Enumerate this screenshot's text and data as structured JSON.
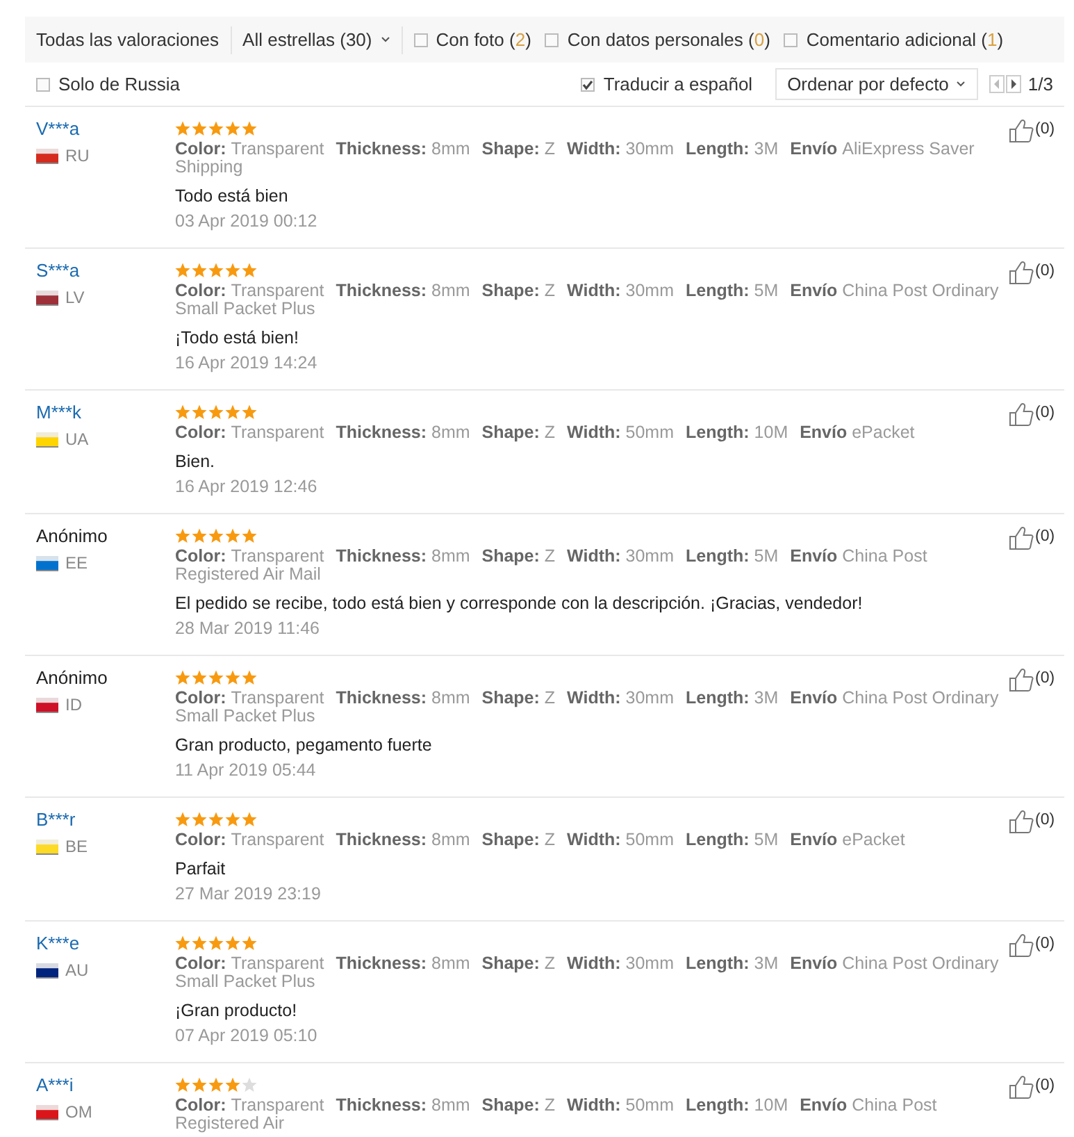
{
  "filters": {
    "all_label": "Todas las valoraciones",
    "stars_dropdown": "All estrellas (30)",
    "checks": [
      {
        "label": "Con foto",
        "count": "(2)",
        "checked": false
      },
      {
        "label": "Con datos personales",
        "count": "(0)",
        "checked": false
      },
      {
        "label": "Comentario adicional",
        "count": "(1)",
        "checked": false
      }
    ]
  },
  "options": {
    "country_filter": {
      "label": "Solo de Russia",
      "checked": false
    },
    "translate": {
      "label": "Traducir a español",
      "checked": true
    },
    "sort": "Ordenar por defecto",
    "page": "1/3"
  },
  "reviews": [
    {
      "kind": "user",
      "name": "V***a",
      "country": "RU",
      "color": "#d52b1e",
      "stars": 5,
      "attrs": [
        {
          "label": "Color:",
          "value": "Transparent"
        },
        {
          "label": "Thickness:",
          "value": "8mm"
        },
        {
          "label": "Shape:",
          "value": "Z"
        },
        {
          "label": "Width:",
          "value": "30mm"
        },
        {
          "label": "Length:",
          "value": "3M"
        },
        {
          "label": "Envío",
          "value": "AliExpress Saver Shipping"
        }
      ],
      "comment": "Todo está bien",
      "date": "03 Apr 2019 00:12",
      "likes": "(0)"
    },
    {
      "kind": "user",
      "name": "S***a",
      "country": "LV",
      "color": "#9e3039",
      "stars": 5,
      "attrs": [
        {
          "label": "Color:",
          "value": "Transparent"
        },
        {
          "label": "Thickness:",
          "value": "8mm"
        },
        {
          "label": "Shape:",
          "value": "Z"
        },
        {
          "label": "Width:",
          "value": "30mm"
        },
        {
          "label": "Length:",
          "value": "5M"
        },
        {
          "label": "Envío",
          "value": "China Post Ordinary Small Packet Plus"
        }
      ],
      "comment": "¡Todo está bien!",
      "date": "16 Apr 2019 14:24",
      "likes": "(0)"
    },
    {
      "kind": "user",
      "name": "M***k",
      "country": "UA",
      "color": "#ffd500",
      "stars": 5,
      "attrs": [
        {
          "label": "Color:",
          "value": "Transparent"
        },
        {
          "label": "Thickness:",
          "value": "8mm"
        },
        {
          "label": "Shape:",
          "value": "Z"
        },
        {
          "label": "Width:",
          "value": "50mm"
        },
        {
          "label": "Length:",
          "value": "10M"
        },
        {
          "label": "Envío",
          "value": "ePacket"
        }
      ],
      "comment": "Bien.",
      "date": "16 Apr 2019 12:46",
      "likes": "(0)"
    },
    {
      "kind": "anonymous",
      "name": "Anónimo",
      "country": "EE",
      "color": "#0072ce",
      "stars": 5,
      "attrs": [
        {
          "label": "Color:",
          "value": "Transparent"
        },
        {
          "label": "Thickness:",
          "value": "8mm"
        },
        {
          "label": "Shape:",
          "value": "Z"
        },
        {
          "label": "Width:",
          "value": "30mm"
        },
        {
          "label": "Length:",
          "value": "5M"
        },
        {
          "label": "Envío",
          "value": "China Post Registered Air Mail"
        }
      ],
      "comment": "El pedido se recibe, todo está bien y corresponde con la descripción. ¡Gracias, vendedor!",
      "date": "28 Mar 2019 11:46",
      "likes": "(0)"
    },
    {
      "kind": "anonymous",
      "name": "Anónimo",
      "country": "ID",
      "color": "#ce1126",
      "stars": 5,
      "attrs": [
        {
          "label": "Color:",
          "value": "Transparent"
        },
        {
          "label": "Thickness:",
          "value": "8mm"
        },
        {
          "label": "Shape:",
          "value": "Z"
        },
        {
          "label": "Width:",
          "value": "30mm"
        },
        {
          "label": "Length:",
          "value": "3M"
        },
        {
          "label": "Envío",
          "value": "China Post Ordinary Small Packet Plus"
        }
      ],
      "comment": "Gran producto, pegamento fuerte",
      "date": "11 Apr 2019 05:44",
      "likes": "(0)"
    },
    {
      "kind": "user",
      "name": "B***r",
      "country": "BE",
      "color": "#fdda24",
      "stars": 5,
      "attrs": [
        {
          "label": "Color:",
          "value": "Transparent"
        },
        {
          "label": "Thickness:",
          "value": "8mm"
        },
        {
          "label": "Shape:",
          "value": "Z"
        },
        {
          "label": "Width:",
          "value": "50mm"
        },
        {
          "label": "Length:",
          "value": "5M"
        },
        {
          "label": "Envío",
          "value": "ePacket"
        }
      ],
      "comment": "Parfait",
      "date": "27 Mar 2019 23:19",
      "likes": "(0)"
    },
    {
      "kind": "user",
      "name": "K***e",
      "country": "AU",
      "color": "#00247d",
      "stars": 5,
      "attrs": [
        {
          "label": "Color:",
          "value": "Transparent"
        },
        {
          "label": "Thickness:",
          "value": "8mm"
        },
        {
          "label": "Shape:",
          "value": "Z"
        },
        {
          "label": "Width:",
          "value": "30mm"
        },
        {
          "label": "Length:",
          "value": "3M"
        },
        {
          "label": "Envío",
          "value": "China Post Ordinary Small Packet Plus"
        }
      ],
      "comment": "¡Gran producto!",
      "date": "07 Apr 2019 05:10",
      "likes": "(0)"
    },
    {
      "kind": "user",
      "name": "A***i",
      "country": "OM",
      "color": "#db161b",
      "stars": 4,
      "attrs": [
        {
          "label": "Color:",
          "value": "Transparent"
        },
        {
          "label": "Thickness:",
          "value": "8mm"
        },
        {
          "label": "Shape:",
          "value": "Z"
        },
        {
          "label": "Width:",
          "value": "50mm"
        },
        {
          "label": "Length:",
          "value": "10M"
        },
        {
          "label": "Envío",
          "value": "China Post Registered Air"
        }
      ],
      "likes": "(0)"
    }
  ]
}
